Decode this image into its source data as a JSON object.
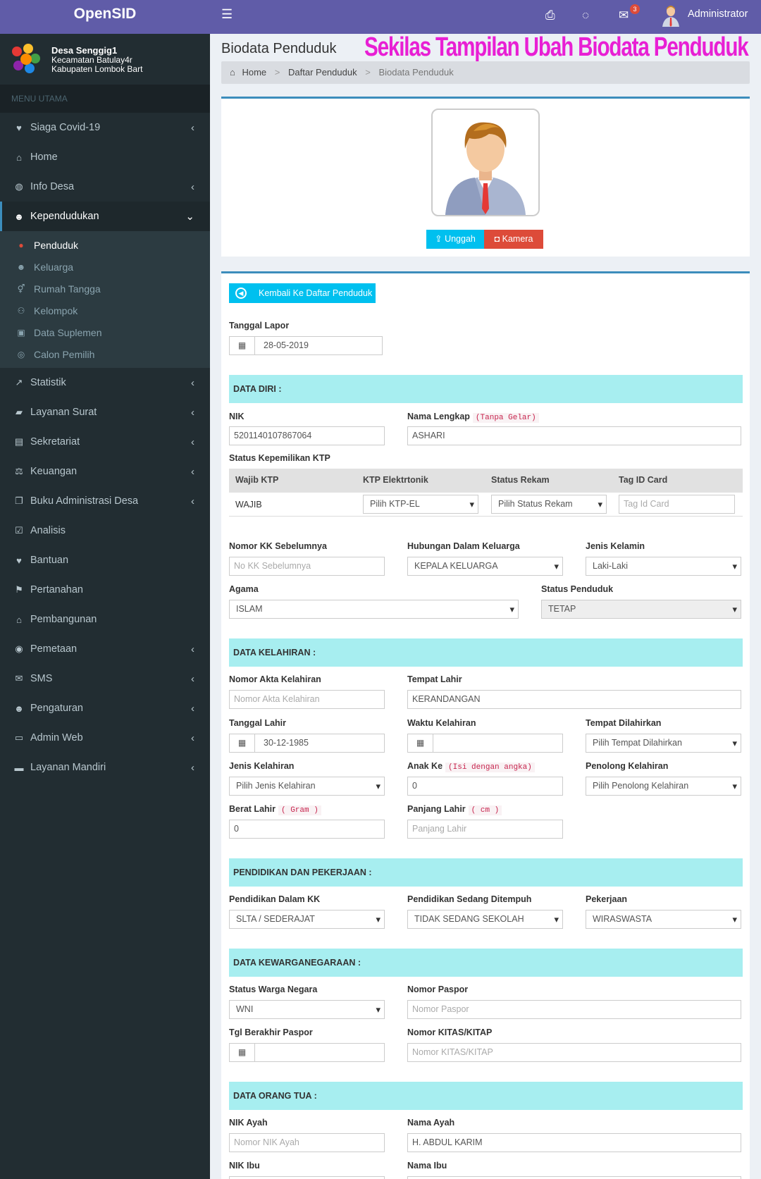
{
  "app": {
    "title": "OpenSID"
  },
  "desa": {
    "name": "Desa Senggig1",
    "kecamatan": "Kecamatan Batulay4r",
    "kabupaten": "Kabupaten Lombok Bart"
  },
  "sidebar": {
    "header": "MENU UTAMA",
    "items": [
      {
        "label": "Siaga Covid-19",
        "icon": "heartbeat-icon",
        "glyph": "♥",
        "chevron": "‹"
      },
      {
        "label": "Home",
        "icon": "home-icon",
        "glyph": "⌂",
        "chevron": ""
      },
      {
        "label": "Info Desa",
        "icon": "dashboard-icon",
        "glyph": "◍",
        "chevron": "‹"
      },
      {
        "label": "Kependudukan",
        "icon": "users-icon",
        "glyph": "☻",
        "chevron": "⌄"
      },
      {
        "label": "Statistik",
        "icon": "chart-icon",
        "glyph": "↗",
        "chevron": "‹"
      },
      {
        "label": "Layanan Surat",
        "icon": "book-icon",
        "glyph": "▰",
        "chevron": "‹"
      },
      {
        "label": "Sekretariat",
        "icon": "archive-icon",
        "glyph": "▤",
        "chevron": "‹"
      },
      {
        "label": "Keuangan",
        "icon": "balance-icon",
        "glyph": "⚖",
        "chevron": "‹"
      },
      {
        "label": "Buku Administrasi Desa",
        "icon": "copy-icon",
        "glyph": "❐",
        "chevron": "‹"
      },
      {
        "label": "Analisis",
        "icon": "check-square-icon",
        "glyph": "☑",
        "chevron": ""
      },
      {
        "label": "Bantuan",
        "icon": "heart-icon",
        "glyph": "♥",
        "chevron": ""
      },
      {
        "label": "Pertanahan",
        "icon": "signpost-icon",
        "glyph": "⚑",
        "chevron": ""
      },
      {
        "label": "Pembangunan",
        "icon": "institution-icon",
        "glyph": "⌂",
        "chevron": ""
      },
      {
        "label": "Pemetaan",
        "icon": "globe-icon",
        "glyph": "◉",
        "chevron": "‹"
      },
      {
        "label": "SMS",
        "icon": "envelope-icon",
        "glyph": "✉",
        "chevron": "‹"
      },
      {
        "label": "Pengaturan",
        "icon": "users-cog-icon",
        "glyph": "☻",
        "chevron": "‹"
      },
      {
        "label": "Admin Web",
        "icon": "desktop-icon",
        "glyph": "▭",
        "chevron": "‹"
      },
      {
        "label": "Layanan Mandiri",
        "icon": "drive-icon",
        "glyph": "▬",
        "chevron": "‹"
      }
    ],
    "sub": [
      {
        "label": "Penduduk",
        "icon": "user-icon",
        "glyph": "●"
      },
      {
        "label": "Keluarga",
        "icon": "users-icon",
        "glyph": "☻"
      },
      {
        "label": "Rumah Tangga",
        "icon": "venus-mars-icon",
        "glyph": "⚥"
      },
      {
        "label": "Kelompok",
        "icon": "sitemap-icon",
        "glyph": "⚇"
      },
      {
        "label": "Data Suplemen",
        "icon": "gift-icon",
        "glyph": "▣"
      },
      {
        "label": "Calon Pemilih",
        "icon": "podcast-icon",
        "glyph": "◎"
      }
    ]
  },
  "topbar": {
    "user": "Administrator",
    "mail_count": "3"
  },
  "page": {
    "title": "Biodata Penduduk",
    "annotation": "Sekilas Tampilan Ubah Biodata Penduduk"
  },
  "breadcrumb": [
    "Home",
    "Daftar Penduduk",
    "Biodata Penduduk"
  ],
  "photo": {
    "upload": "Unggah",
    "camera": "Kamera"
  },
  "form": {
    "back": "Kembali Ke Daftar Penduduk",
    "tanggal_lapor": {
      "label": "Tanggal Lapor",
      "value": "28-05-2019"
    },
    "sec_diri": "DATA DIRI :",
    "nik": {
      "label": "NIK",
      "value": "5201140107867064"
    },
    "nama": {
      "label": "Nama Lengkap",
      "note": "(Tanpa Gelar)",
      "value": "ASHARI"
    },
    "ktp": {
      "label": "Status Kepemilikan KTP",
      "headers": [
        "Wajib KTP",
        "KTP Elektrtonik",
        "Status Rekam",
        "Tag ID Card"
      ],
      "wajib": "WAJIB",
      "elektronik": "Pilih KTP-EL",
      "rekam": "Pilih Status Rekam",
      "tag_ph": "Tag Id Card"
    },
    "no_kk": {
      "label": "Nomor KK Sebelumnya",
      "placeholder": "No KK Sebelumnya"
    },
    "hubungan": {
      "label": "Hubungan Dalam Keluarga",
      "value": "KEPALA KELUARGA"
    },
    "jk": {
      "label": "Jenis Kelamin",
      "value": "Laki-Laki"
    },
    "agama": {
      "label": "Agama",
      "value": "ISLAM"
    },
    "status": {
      "label": "Status Penduduk",
      "value": "TETAP"
    },
    "sec_lahir": "DATA KELAHIRAN :",
    "akta": {
      "label": "Nomor Akta Kelahiran",
      "placeholder": "Nomor Akta Kelahiran"
    },
    "tempat_lahir": {
      "label": "Tempat Lahir",
      "value": "KERANDANGAN"
    },
    "tgl_lahir": {
      "label": "Tanggal Lahir",
      "value": "30-12-1985"
    },
    "waktu": {
      "label": "Waktu Kelahiran"
    },
    "tempat_dilahirkan": {
      "label": "Tempat Dilahirkan",
      "value": "Pilih Tempat Dilahirkan"
    },
    "jenis_lahir": {
      "label": "Jenis Kelahiran",
      "value": "Pilih Jenis Kelahiran"
    },
    "anak_ke": {
      "label": "Anak Ke",
      "note": "(Isi dengan angka)",
      "value": "0"
    },
    "penolong": {
      "label": "Penolong Kelahiran",
      "value": "Pilih Penolong Kelahiran"
    },
    "berat": {
      "label": "Berat Lahir",
      "note": "( Gram )",
      "value": "0"
    },
    "panjang": {
      "label": "Panjang Lahir",
      "note": "( cm )",
      "placeholder": "Panjang Lahir"
    },
    "sec_didik": "PENDIDIKAN DAN PEKERJAAN :",
    "pend_kk": {
      "label": "Pendidikan Dalam KK",
      "value": "SLTA / SEDERAJAT"
    },
    "pend_tempuh": {
      "label": "Pendidikan Sedang Ditempuh",
      "value": "TIDAK SEDANG SEKOLAH"
    },
    "kerja": {
      "label": "Pekerjaan",
      "value": "WIRASWASTA"
    },
    "sec_warga": "DATA KEWARGANEGARAAN :",
    "warga": {
      "label": "Status Warga Negara",
      "value": "WNI"
    },
    "paspor": {
      "label": "Nomor Paspor",
      "placeholder": "Nomor Paspor"
    },
    "tgl_paspor": {
      "label": "Tgl Berakhir Paspor"
    },
    "kitas": {
      "label": "Nomor KITAS/KITAP",
      "placeholder": "Nomor KITAS/KITAP"
    },
    "sec_ortu": "DATA ORANG TUA :",
    "nik_ayah": {
      "label": "NIK Ayah",
      "placeholder": "Nomor NIK Ayah"
    },
    "nama_ayah": {
      "label": "Nama Ayah",
      "value": "H. ABDUL KARIM"
    },
    "nik_ibu": {
      "label": "NIK Ibu"
    },
    "nama_ibu": {
      "label": "Nama Ibu"
    }
  },
  "colors": {
    "brand": "#605ca8",
    "sidebar": "#222d32",
    "section": "#a7eef0",
    "info": "#00c0ef",
    "danger": "#dd4b39"
  }
}
